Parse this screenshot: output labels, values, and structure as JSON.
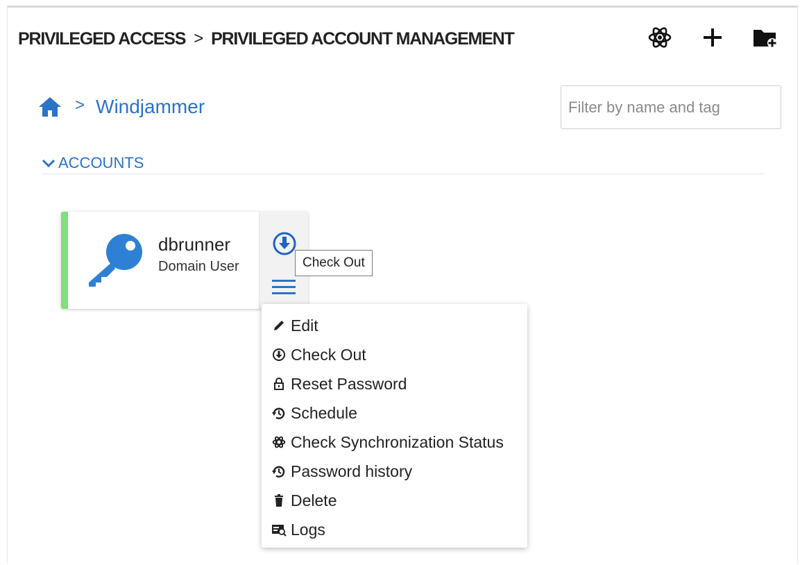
{
  "header": {
    "crumb_1": "PRIVILEGED ACCESS",
    "separator": ">",
    "crumb_2": "PRIVILEGED ACCOUNT MANAGEMENT",
    "actions": [
      {
        "icon": "atom-icon"
      },
      {
        "icon": "plus-icon"
      },
      {
        "icon": "folder-add-icon"
      }
    ]
  },
  "breadcrumb": {
    "home_icon": "home-icon",
    "separator": ">",
    "current": "Windjammer"
  },
  "filter": {
    "placeholder": "Filter by name and tag",
    "value": ""
  },
  "section": {
    "label": "ACCOUNTS",
    "expanded": true
  },
  "account_card": {
    "name": "dbrunner",
    "type": "Domain User",
    "status_color": "#7fe07a",
    "icon": "key-icon"
  },
  "tooltip": {
    "text": "Check Out"
  },
  "menu": {
    "items": [
      {
        "label": "Edit",
        "icon": "pencil-icon"
      },
      {
        "label": "Check Out",
        "icon": "checkout-icon"
      },
      {
        "label": "Reset Password",
        "icon": "lock-icon"
      },
      {
        "label": "Schedule",
        "icon": "schedule-icon"
      },
      {
        "label": "Check Synchronization Status",
        "icon": "atom-icon"
      },
      {
        "label": "Password history",
        "icon": "history-icon"
      },
      {
        "label": "Delete",
        "icon": "trash-icon"
      },
      {
        "label": "Logs",
        "icon": "logs-icon"
      }
    ]
  },
  "colors": {
    "accent": "#2a73c6",
    "text": "#222222",
    "status_ok": "#7fe07a"
  }
}
